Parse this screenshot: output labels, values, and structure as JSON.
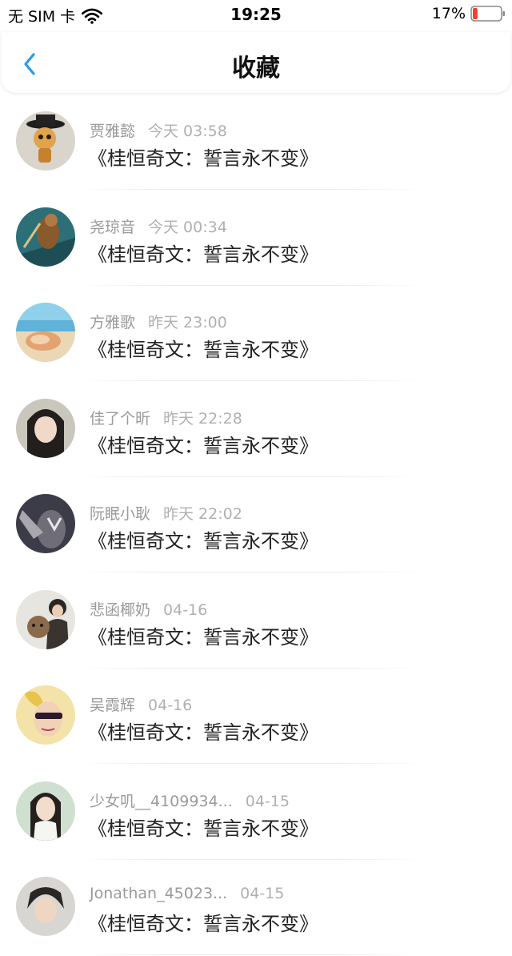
{
  "status_bar": {
    "carrier": "无 SIM 卡",
    "time": "19:25",
    "battery": "17%",
    "battery_level": 0.17,
    "battery_color": "#ff3b30"
  },
  "nav": {
    "title": "收藏",
    "back_icon": "chevron-left-icon",
    "accent": "#2a9ae8"
  },
  "favorites": [
    {
      "user": "贾雅懿",
      "time": "今天 03:58",
      "title": "《桂恒奇文：誓言永不变》"
    },
    {
      "user": "尧琼音",
      "time": "今天 00:34",
      "title": "《桂恒奇文：誓言永不变》"
    },
    {
      "user": "方雅歌",
      "time": "昨天 23:00",
      "title": "《桂恒奇文：誓言永不变》"
    },
    {
      "user": "佳了个昕",
      "time": "昨天 22:28",
      "title": "《桂恒奇文：誓言永不变》"
    },
    {
      "user": "阮眠小耿",
      "time": "昨天 22:02",
      "title": "《桂恒奇文：誓言永不变》"
    },
    {
      "user": "悲函椰奶",
      "time": "04-16",
      "title": "《桂恒奇文：誓言永不变》"
    },
    {
      "user": "吴霞辉",
      "time": "04-16",
      "title": "《桂恒奇文：誓言永不变》"
    },
    {
      "user": "少女叽__4109934...",
      "time": "04-15",
      "title": "《桂恒奇文：誓言永不变》"
    },
    {
      "user": "Jonathan_45023...",
      "time": "04-15",
      "title": "《桂恒奇文：誓言永不变》"
    }
  ]
}
